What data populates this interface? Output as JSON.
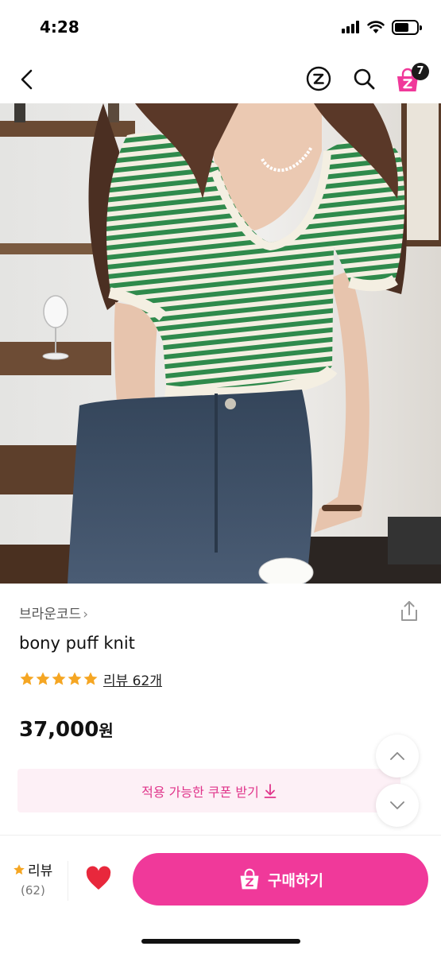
{
  "status_bar": {
    "time": "4:28"
  },
  "nav": {
    "cart_count": "7"
  },
  "product": {
    "brand": "브라운코드",
    "brand_chevron": "›",
    "name": "bony puff knit",
    "rating_stars": 5,
    "review_link": "리뷰 62개",
    "price": "37,000",
    "price_unit": "원"
  },
  "coupon": {
    "label": "적용 가능한 쿠폰 받기"
  },
  "bottom_bar": {
    "review_label": "리뷰",
    "review_count": "(62)",
    "buy_label": "구매하기"
  },
  "icons": {
    "back": "chevron-left-icon",
    "zigzag": "zigzag-logo-icon",
    "search": "search-icon",
    "cart": "cart-icon",
    "share": "share-icon",
    "star": "star-icon",
    "heart": "heart-icon",
    "scroll_up": "chevron-up-icon",
    "scroll_down": "chevron-down-icon"
  },
  "colors": {
    "accent_pink": "#f0399a",
    "coupon_bg": "#fdf0f6",
    "coupon_text": "#e0358b",
    "star": "#f5a623",
    "heart": "#e8283c"
  }
}
